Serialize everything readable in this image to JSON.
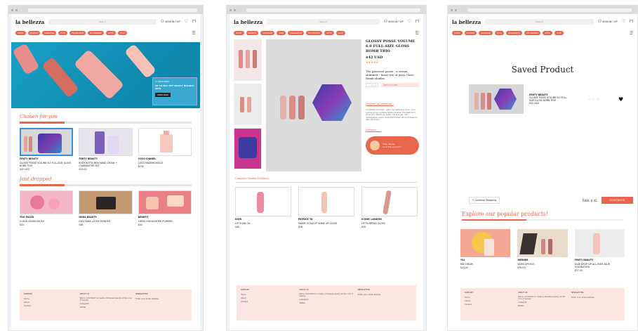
{
  "brand": "la bellezza",
  "search_placeholder": "Search",
  "signin_label": "SIGN IN / UP",
  "nav": [
    "HOME",
    "MAKEUP",
    "SKINCARE",
    "HAIR",
    "FRAGRANCE",
    "MY ORDERS",
    "GIFTS",
    "SALE"
  ],
  "home": {
    "hero_card": {
      "line1": "LA BELLEZZA",
      "line2": "UP TO 50% OFF SELECT HOLIDAY SETS",
      "button": "SHOP NOW"
    },
    "chosen_title": "Chosen for you",
    "chosen": [
      {
        "brand": "FENTY BEAUTY",
        "name": "GLOSSY POSSE VOLUME 6.0 FULL-SIZE GLOSS BOMB TRIO",
        "price": "$42 USD"
      },
      {
        "brand": "FENTY BEAUTY",
        "name": "BODY BUTTA MINI HAND CREAM + CHARMASTER SET",
        "price": "$19.00"
      },
      {
        "brand": "COCO CHANEL",
        "name": "COCO MADEMOISELLE",
        "price": "$100"
      }
    ],
    "dropped_title": "Just dropped",
    "dropped": [
      {
        "brand": "TOO FACED",
        "name": "CLOUD CRUSH BLUSH",
        "price": "$24"
      },
      {
        "brand": "HUDA BEAUTY",
        "name": "EASY BAKE LOOSE POWDER",
        "price": "$38"
      },
      {
        "brand": "BENEFIT",
        "name": "CHEEK HIGHLIGHTER POWDER",
        "price": "$30"
      }
    ],
    "footer": {
      "col1": [
        "SUPPORT",
        "Home",
        "About",
        "Contact"
      ],
      "col2": [
        "ABOUT US",
        "We're committed to create a timeless beauty at the core of beauty",
        "Instagram",
        "Twitter"
      ],
      "col3": [
        "NEWSLETTER",
        "Enter your email address"
      ]
    }
  },
  "product": {
    "title": "GLOSSY POSSE VOLUME 6.0 FULL-SIZE GLOSS BOMB TRIO",
    "price": "$42 USD",
    "stars": "★★★★★",
    "description": "The glossiest posse - a cream, shimmer - lined trio of juicy Gloss Bomb shades",
    "qty": "1",
    "add_to_cart": "ADD TO CART",
    "info_title": "Product Information",
    "info_text": "Complexes and best - seller trio delivering more, more here lip gloss, contains holiday shades. This fast trio 3 shine mini delivering us the cult-fave gel - The unstoppable Cream, Gloss Bomb Heat, shine limitless for ultra-dimension.",
    "reviews_title": "Reviews",
    "review": {
      "author": "Ellen Renee",
      "text": "Love the product!"
    },
    "compare_title": "Compare Similar Products",
    "compare": [
      {
        "brand": "DIOR",
        "name": "LIP GLOW OIL",
        "price": "$40"
      },
      {
        "brand": "PATRICK TA",
        "name": "MAJOR GLOW LIP SHINE LIP GLOSS",
        "price": "$28"
      },
      {
        "brand": "ICONIC LONDON",
        "name": "LIP PLUMPING GLOSS",
        "price": "$25"
      }
    ]
  },
  "saved": {
    "title": "Saved Product",
    "item": {
      "brand": "FENTY BEAUTY",
      "name": "GLOSSY POSSE VOLUME 6.0 FULL-SIZE GLOSS BOMB TRIO",
      "price": "$42 USD"
    },
    "continue_shopping": "Continue Shopping",
    "total": "Total: $ 42",
    "continue_btn": "CONTINUE",
    "explore_title": "Explore our popular products!",
    "explore": [
      {
        "brand": "YSL",
        "name": "RIB CREAM",
        "price": "$24.00"
      },
      {
        "brand": "MERNER",
        "name": "SATIN LIPSTICK",
        "price": "$30.00"
      },
      {
        "brand": "FENTY BEAUTY",
        "name": "EAZE DROP LIP ALL-OVER BLUR FOUNDATION",
        "price": "$37.00"
      }
    ]
  }
}
